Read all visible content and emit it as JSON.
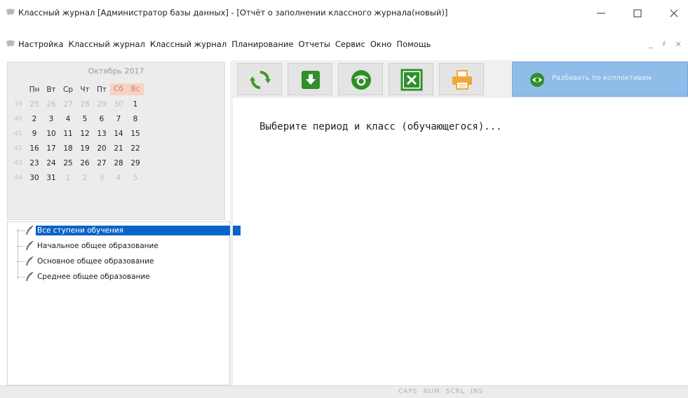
{
  "window": {
    "title": "Классный журнал [Администратор базы данных] - [Отчёт о заполнении классного журнала(новый)]",
    "controls": {
      "minimize": "minimize",
      "maximize": "maximize",
      "close": "close"
    }
  },
  "menu": {
    "items": [
      "Настройка",
      "Классный журнал",
      "Классный журнал",
      "Планирование",
      "Отчеты",
      "Сервис",
      "Окно",
      "Помощь"
    ],
    "mdi_controls": "_ ♯ ×"
  },
  "calendar": {
    "month": "Октябрь 2017",
    "headers": [
      "Пн",
      "Вт",
      "Ср",
      "Чт",
      "Пт",
      "Сб",
      "Вс"
    ],
    "weeks": [
      {
        "week": "39",
        "days": [
          "25",
          "26",
          "27",
          "28",
          "29",
          "30",
          "1"
        ],
        "off": [
          true,
          true,
          true,
          true,
          true,
          true,
          false
        ]
      },
      {
        "week": "40",
        "days": [
          "2",
          "3",
          "4",
          "5",
          "6",
          "7",
          "8"
        ],
        "off": [
          false,
          false,
          false,
          false,
          false,
          false,
          false
        ]
      },
      {
        "week": "41",
        "days": [
          "9",
          "10",
          "11",
          "12",
          "13",
          "14",
          "15"
        ],
        "off": [
          false,
          false,
          false,
          false,
          false,
          false,
          false
        ]
      },
      {
        "week": "42",
        "days": [
          "16",
          "17",
          "18",
          "19",
          "20",
          "21",
          "22"
        ],
        "off": [
          false,
          false,
          false,
          false,
          false,
          false,
          false
        ]
      },
      {
        "week": "43",
        "days": [
          "23",
          "24",
          "25",
          "26",
          "27",
          "28",
          "29"
        ],
        "off": [
          false,
          false,
          false,
          false,
          false,
          false,
          false
        ]
      },
      {
        "week": "44",
        "days": [
          "30",
          "31",
          "1",
          "2",
          "3",
          "4",
          "5"
        ],
        "off": [
          false,
          false,
          true,
          true,
          true,
          true,
          true
        ]
      }
    ]
  },
  "tree": {
    "items": [
      {
        "label": "Все ступени обучения",
        "selected": true
      },
      {
        "label": "Начальное общее образование",
        "selected": false
      },
      {
        "label": "Основное общее образование",
        "selected": false
      },
      {
        "label": "Среднее общее образование",
        "selected": false
      }
    ]
  },
  "toolbar": {
    "buttons": [
      {
        "name": "refresh-button",
        "icon": "refresh-icon",
        "color": "#3c9a2a"
      },
      {
        "name": "download-button",
        "icon": "download-icon",
        "color": "#2f8f2a"
      },
      {
        "name": "view-button",
        "icon": "eye-shield-icon",
        "color": "#2f8f2a"
      },
      {
        "name": "excel-export-button",
        "icon": "excel-icon",
        "color": "#2f8f2a"
      },
      {
        "name": "print-button",
        "icon": "printer-icon",
        "color": "#f2a53a"
      }
    ],
    "collective_button": {
      "label": "Разбивать по коллективам",
      "icon": "eye-icon"
    }
  },
  "content": {
    "message": "Выберите период и класс (обучающегося)..."
  },
  "status": {
    "keys": [
      "CAPS",
      "NUM",
      "SCRL",
      "INS"
    ]
  }
}
